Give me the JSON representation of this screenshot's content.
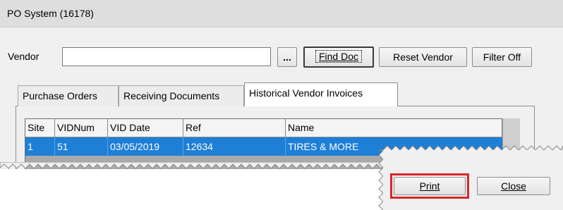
{
  "window": {
    "title": "PO System (16178)"
  },
  "vendor": {
    "label": "Vendor",
    "value": "",
    "browse_label": "...",
    "find_doc_label": "Find Doc",
    "reset_vendor_label": "Reset Vendor",
    "filter_off_label": "Filter Off"
  },
  "tabs": [
    {
      "label": "Purchase Orders",
      "active": false
    },
    {
      "label": "Receiving Documents",
      "active": false
    },
    {
      "label": "Historical Vendor Invoices",
      "active": true
    }
  ],
  "table": {
    "columns": [
      "Site",
      "VIDNum",
      "VID Date",
      "Ref",
      "Name"
    ],
    "rows": [
      {
        "cells": [
          "1",
          "51",
          "03/05/2019",
          "12634",
          "TIRES & MORE"
        ],
        "selected": true
      }
    ]
  },
  "buttons": {
    "print_label": "Print",
    "close_label": "Close"
  },
  "colors": {
    "selection": "#1e7fd6",
    "highlight_border": "#d9262c"
  }
}
